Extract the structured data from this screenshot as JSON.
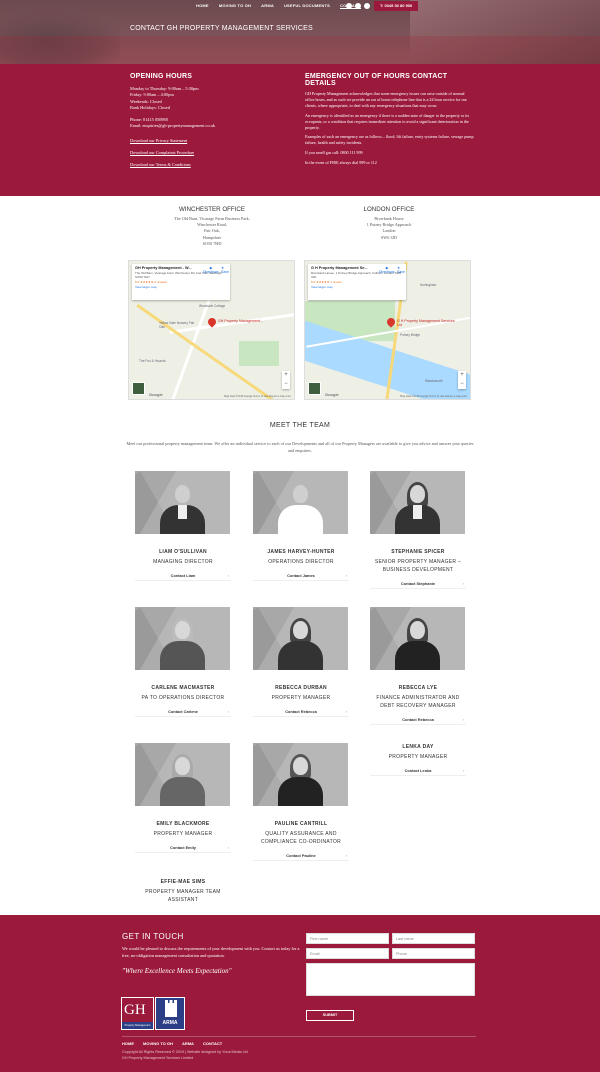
{
  "nav": {
    "items": [
      "HOME",
      "MOVING TO GH",
      "ARMA",
      "USEFUL DOCUMENTS",
      "CONTACT"
    ],
    "phone": "T: 0345 30 80 900"
  },
  "page_title": "CONTACT GH PROPERTY MANAGEMENT SERVICES",
  "hours": {
    "title": "OPENING HOURS",
    "lines": [
      "Monday to Thursday: 9:00am – 5:30pm",
      "Friday: 9:00am – 4:00pm",
      "Weekends: Closed",
      "Bank Holidays: Closed"
    ],
    "phone": "Phone: 01415 050988",
    "email": "Email:  enquiries@gh-propertymanagement.co.uk",
    "links": [
      "Download our Privacy Statement",
      "Download our Complaints Procedure",
      "Download our Terms & Conditions"
    ]
  },
  "emergency": {
    "title": "EMERGENCY OUT OF HOURS CONTACT DETAILS",
    "p1": "GH Property Management acknowledges that some emergency issues can arise outside of normal office hours, and as such we provide an out of hours telephone line that is a 24 hour service for our clients, where appropriate, to deal with any emergency situations that may occur.",
    "p2": "An emergency is identified as an emergency if there is a sudden state of danger to the property or its occupants, or a condition that requires immediate attention to avoid a significant deterioration in the property.",
    "p3": "Examples of such an emergency are as follows – flood, lift failure, entry systems failure, sewage pump failure, health and safety incidents.",
    "p4": "If you smell gas call: 0800 111 999",
    "p5": "In the event of FIRE always dial 999 or 112"
  },
  "offices": {
    "winchester": {
      "title": "WINCHESTER OFFICE",
      "address": [
        "The Old Barn, Vicarage Farm Business Park,",
        "Winchester Road,",
        "Fair Oak,",
        "Hampshire",
        "SO50 7HD"
      ],
      "map": {
        "name": "GH Property Management - W...",
        "addr": "The Old Barn, Vicarage Farm Winchester Rd, Fair Oak, Eastleigh SO50 7HD",
        "rating": "5.0 ★★★★★  2 reviews",
        "view": "View larger map",
        "pin_label": "GH Property Management...",
        "directions": "Directions",
        "save": "Save",
        "place1": "Woodside Cottage",
        "place2": "Yellow Gate Nursery Fair Oak",
        "place3": "The Fox & Hounds",
        "footer": "Map data ©2019 Google   Terms of Use   Report a map error"
      }
    },
    "london": {
      "title": "LONDON OFFICE",
      "address": [
        "Riverbank House",
        "1 Putney Bridge Approach",
        "London",
        "SW6 3JD"
      ],
      "map": {
        "name": "G H Property Management Se...",
        "addr": "Riverbank House, 1 Putney Bridge Approach, Fulham, London SW6 3JD",
        "rating": "5.0 ★★★★★  1 review",
        "view": "View larger map",
        "pin_label": "G H Property Management Services Ltd",
        "directions": "Directions",
        "save": "Save",
        "place1": "Hurlingham",
        "place2": "Putney Bridge",
        "place3": "Wandsworth",
        "footer": "Map data ©2019 Google   Terms of Use   Report a map error"
      }
    }
  },
  "team": {
    "title": "MEET THE TEAM",
    "intro": "Meet our professional property management team.   We offer an individual service to each of our Developments and all of our Property Managers are available to give you advice and answer your queries and enquiries.",
    "members": [
      {
        "name": "LIAM O'SULLIVAN",
        "role": "MANAGING DIRECTOR",
        "contact": "Contact Liam"
      },
      {
        "name": "JAMES HARVEY-HUNTER",
        "role": "OPERATIONS DIRECTOR",
        "contact": "Contact James"
      },
      {
        "name": "STEPHANIE SPICER",
        "role": "SENIOR PROPERTY MANAGER – BUSINESS DEVELOPMENT",
        "contact": "Contact Stephanie"
      },
      {
        "name": "CARLENE MACMASTER",
        "role": "PA TO OPERATIONS DIRECTOR",
        "contact": "Contact Carlene"
      },
      {
        "name": "REBECCA DURBAN",
        "role": "PROPERTY MANAGER",
        "contact": "Contact Rebecca"
      },
      {
        "name": "REBECCA LYE",
        "role": "FINANCE ADMINISTRATOR AND DEBT RECOVERY MANAGER",
        "contact": "Contact Rebecca"
      },
      {
        "name": "LENKA DAY",
        "role": "PROPERTY MANAGER",
        "contact": "Contact Lenka"
      },
      {
        "name": "EMILY BLACKMORE",
        "role": "PROPERTY MANAGER",
        "contact": "Contact Emily"
      },
      {
        "name": "PAULINE CANTRILL",
        "role": "QUALITY ASSURANCE AND COMPLIANCE CO-ORDINATOR",
        "contact": "Contact Pauline"
      },
      {
        "name": "EFFIE-MAE SIMS",
        "role": "PROPERTY MANAGER TEAM ASSISTANT",
        "contact": ""
      }
    ]
  },
  "footer": {
    "title": "GET IN TOUCH",
    "text": "We would be pleased to discuss the requirements of your development with you. Contact us today for a free, no-obligation management consultation and quotation.",
    "tagline": "\"Where Excellence Meets Expectation\"",
    "logo_gh": "GH",
    "logo_gh_sub": "Property Management",
    "logo_arma": "ARMA",
    "form": {
      "first_name": "First name",
      "last_name": "Last name",
      "email": "Email",
      "phone": "Phone",
      "submit": "SUBMIT"
    },
    "nav": [
      "HOME",
      "MOVING TO GH",
      "ARMA",
      "CONTACT"
    ],
    "copy1": "Copyright All Rights Reserved © 2019  |  Website designed by Yuna Media Ltd",
    "copy2": "GH Property Management Services Limited"
  }
}
